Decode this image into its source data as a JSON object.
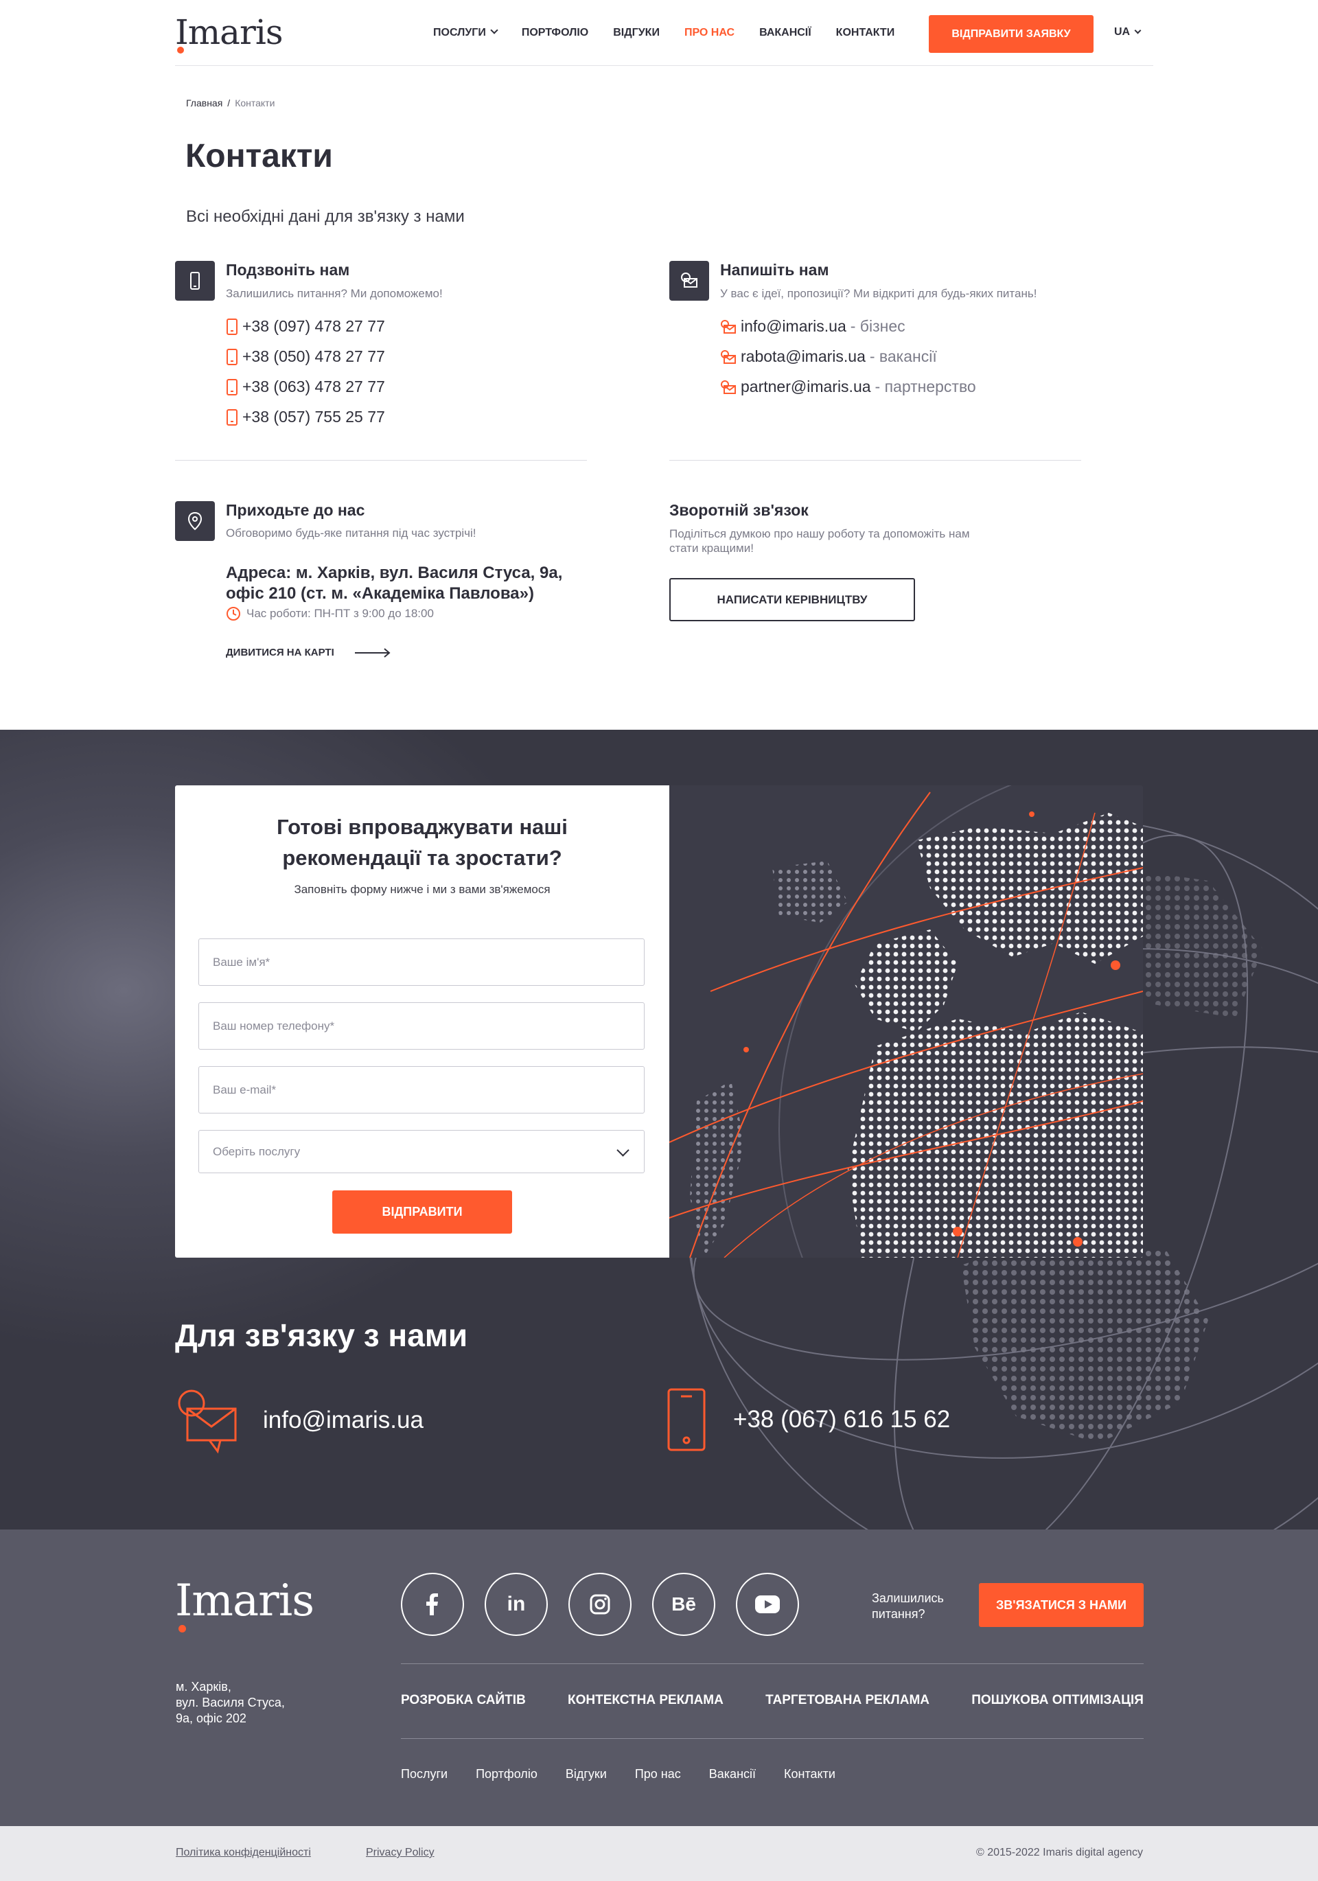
{
  "header": {
    "logo": "Imaris",
    "nav": [
      {
        "label": "Послуги",
        "dropdown": true
      },
      {
        "label": "Портфоліо"
      },
      {
        "label": "Відгуки"
      },
      {
        "label": "Про нас",
        "active": true
      },
      {
        "label": "Вакансії"
      },
      {
        "label": "Контакти"
      }
    ],
    "cta": "Відправити заявку",
    "lang": "UA"
  },
  "breadcrumb": {
    "home": "Главная",
    "current": "Контакти"
  },
  "page": {
    "title": "Контакти",
    "subtitle": "Всі необхідні дані для зв'язку з нами"
  },
  "call": {
    "title": "Подзвоніть нам",
    "subtitle": "Залишились питання? Ми допоможемо!",
    "phones": [
      "+38 (097) 478 27 77",
      "+38 (050) 478 27 77",
      "+38 (063) 478 27 77",
      "+38 (057) 755 25 77"
    ]
  },
  "write": {
    "title": "Напишіть нам",
    "subtitle": "У вас є ідеї, пропозиції? Ми відкриті для будь-яких питань!",
    "emails": [
      {
        "email": "info@imaris.ua",
        "note": "- бізнес"
      },
      {
        "email": "rabota@imaris.ua",
        "note": "- вакансії"
      },
      {
        "email": "partner@imaris.ua",
        "note": "- партнерство"
      }
    ]
  },
  "visit": {
    "title": "Приходьте до нас",
    "subtitle": "Обговоримо будь-яке питання під час зустрічі!",
    "address_line1": "Адреса: м. Харків, вул. Василя Стуса, 9а,",
    "address_line2": "офіс 210 (ст. м. «Академіка Павлова»)",
    "hours": "Час роботи: ПН-ПТ з 9:00 до 18:00",
    "map_link": "Дивитися на карті"
  },
  "feedback": {
    "title": "Зворотній зв'язок",
    "subtitle_line1": "Поділіться думкою про нашу роботу та допоможіть нам",
    "subtitle_line2": "стати кращими!",
    "button": "Написати керівництву"
  },
  "form": {
    "title_line1": "Готові впроваджувати наші",
    "title_line2": "рекомендації та зростати?",
    "subtitle": "Заповніть форму нижче і ми з вами зв'яжемося",
    "name_placeholder": "Ваше ім'я*",
    "phone_placeholder": "Ваш номер телефону*",
    "email_placeholder": "Ваш e-mail*",
    "service_placeholder": "Оберіть послугу",
    "submit": "Відправити"
  },
  "contact_us": {
    "title": "Для зв'язку з нами",
    "email": "info@imaris.ua",
    "phone": "+38 (067) 616 15 62"
  },
  "footer": {
    "logo": "Imaris",
    "address_line1": "м. Харків,",
    "address_line2": "вул. Василя Стуса,",
    "address_line3": "9а, офіс 202",
    "social": [
      "facebook-icon",
      "linkedin-icon",
      "instagram-icon",
      "behance-icon",
      "youtube-icon"
    ],
    "question_line1": "Залишились",
    "question_line2": "питання?",
    "cta": "Зв'язатися з нами",
    "services": [
      "Розробка сайтів",
      "Контекстна реклама",
      "Таргетована реклама",
      "Пошукова оптимізація"
    ],
    "links": [
      "Послуги",
      "Портфоліо",
      "Відгуки",
      "Про нас",
      "Вакансії",
      "Контакти"
    ]
  },
  "bottom": {
    "privacy_ua": "Політика конфіденційності",
    "privacy_en": "Privacy Policy",
    "copyright": "© 2015-2022 Imaris digital agency"
  },
  "colors": {
    "accent": "#ff5a2e",
    "dark": "#383843",
    "footer": "#595966",
    "text": "#2f2f3a"
  }
}
